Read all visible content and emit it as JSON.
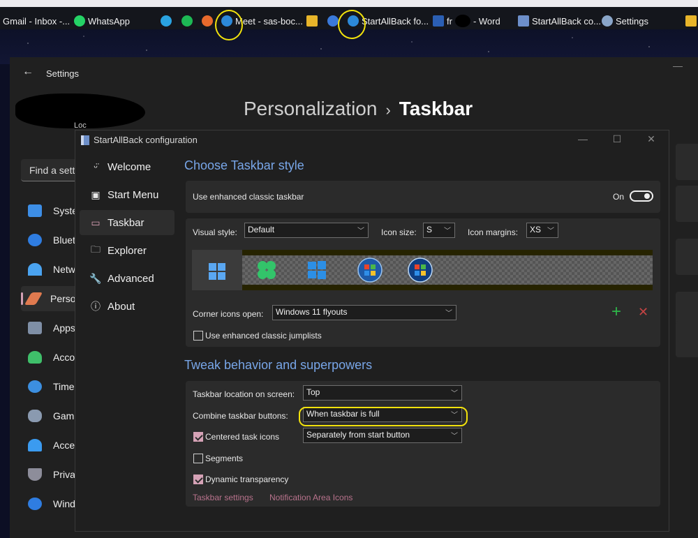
{
  "taskbar": {
    "items": [
      {
        "label": "Gmail - Inbox -...",
        "icon": "gmail-icon"
      },
      {
        "label": "WhatsApp",
        "icon": "whatsapp-icon"
      },
      {
        "label": "Meet - sas-boc...",
        "icon": "edge-icon"
      },
      {
        "label": "StartAllBack fo...",
        "icon": "edge-icon"
      },
      {
        "label": "fr",
        "icon": "word-icon"
      },
      {
        "label": "- Word",
        "icon": ""
      },
      {
        "label": "StartAllBack co...",
        "icon": "startallback-icon"
      },
      {
        "label": "Settings",
        "icon": "gear-icon"
      }
    ]
  },
  "settings": {
    "title": "Settings",
    "breadcrumb": {
      "parent": "Personalization",
      "separator": "›",
      "current": "Taskbar"
    },
    "search_placeholder": "Find a setting",
    "account_sub": "Loc",
    "nav": [
      {
        "label": "System",
        "color": "#3d8ee6"
      },
      {
        "label": "Bluetooth & devices",
        "color": "#2f7de1"
      },
      {
        "label": "Network & internet",
        "color": "#4aa3f0"
      },
      {
        "label": "Personalization",
        "color": "#e07a4f"
      },
      {
        "label": "Apps",
        "color": "#7f8fa6"
      },
      {
        "label": "Accounts",
        "color": "#3fbf6a"
      },
      {
        "label": "Time & language",
        "color": "#3c8fe0"
      },
      {
        "label": "Gaming",
        "color": "#8a9ab0"
      },
      {
        "label": "Accessibility",
        "color": "#3b9bf0"
      },
      {
        "label": "Privacy & security",
        "color": "#8d8d9a"
      },
      {
        "label": "Windows Update",
        "color": "#2f7de1"
      }
    ]
  },
  "sab": {
    "title": "StartAllBack configuration",
    "nav": [
      {
        "label": "Welcome",
        "icon": "smiley-icon",
        "glyph": "ᵕ̈"
      },
      {
        "label": "Start Menu",
        "icon": "start-menu-icon",
        "glyph": "▣"
      },
      {
        "label": "Taskbar",
        "icon": "taskbar-icon",
        "glyph": "▭"
      },
      {
        "label": "Explorer",
        "icon": "folder-icon",
        "glyph": "🗀"
      },
      {
        "label": "Advanced",
        "icon": "wrench-icon",
        "glyph": "🔧"
      },
      {
        "label": "About",
        "icon": "info-icon",
        "glyph": "ⓘ"
      }
    ],
    "style_section": {
      "heading": "Choose Taskbar style",
      "enhanced_label": "Use enhanced classic taskbar",
      "enhanced_state": "On",
      "visual_style_label": "Visual style:",
      "visual_style_value": "Default",
      "icon_size_label": "Icon size:",
      "icon_size_value": "S",
      "icon_margins_label": "Icon margins:",
      "icon_margins_value": "XS",
      "corner_icons_label": "Corner icons open:",
      "corner_icons_value": "Windows 11 flyouts",
      "jumplists_label": "Use enhanced classic jumplists",
      "jumplists_checked": false,
      "add_glyph": "+",
      "remove_glyph": "✕"
    },
    "behavior_section": {
      "heading": "Tweak behavior and superpowers",
      "location_label": "Taskbar location on screen:",
      "location_value": "Top",
      "combine_label": "Combine taskbar buttons:",
      "combine_value": "When taskbar is full",
      "centered_label": "Centered task icons",
      "centered_checked": true,
      "centered_value": "Separately from start button",
      "segments_label": "Segments",
      "segments_checked": false,
      "dynamic_label": "Dynamic transparency",
      "dynamic_checked": true,
      "link_taskbar_settings": "Taskbar settings",
      "link_notification_icons": "Notification Area Icons"
    }
  },
  "colors": {
    "accent_blue": "#78a6e8",
    "accent_pink": "#d5a2b6",
    "link": "#b9738d",
    "annotation": "#f2e20c"
  }
}
